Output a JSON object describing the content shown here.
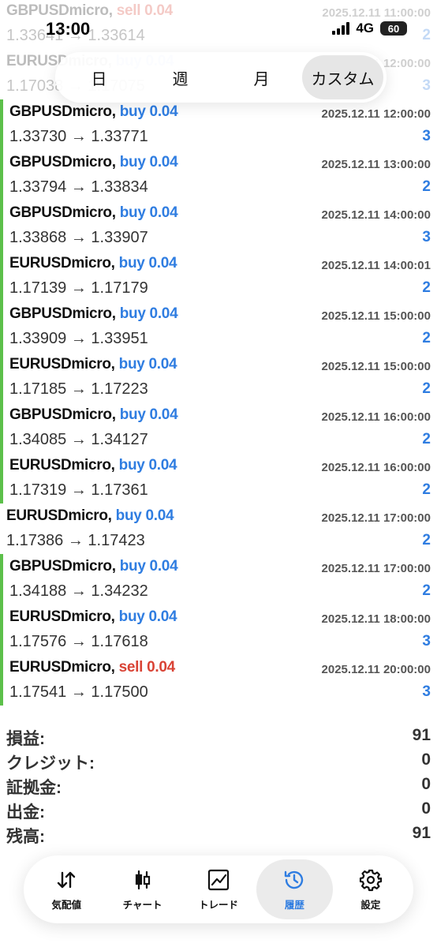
{
  "status": {
    "time": "13:00",
    "network": "4G",
    "battery": "60"
  },
  "periods": [
    {
      "label": "日",
      "active": false
    },
    {
      "label": "週",
      "active": false
    },
    {
      "label": "月",
      "active": false
    },
    {
      "label": "カスタム",
      "active": true
    }
  ],
  "deals": [
    {
      "symbol": "GBPUSDmicro,",
      "side": "sell",
      "side_label": "sell 0.04",
      "time": "2025.12.11 11:00:00",
      "price": "1.33641 → 1.33614",
      "profit": "2",
      "faded": true,
      "green": false
    },
    {
      "symbol": "EURUSDmicro,",
      "side": "buy",
      "side_label": "buy 0.04",
      "time": "2025.12.11 12:00:00",
      "price": "1.17038 → 1.17075",
      "profit": "3",
      "faded": true,
      "green": false
    },
    {
      "symbol": "GBPUSDmicro,",
      "side": "buy",
      "side_label": "buy 0.04",
      "time": "2025.12.11 12:00:00",
      "price": "1.33730 → 1.33771",
      "profit": "3",
      "faded": false,
      "green": true
    },
    {
      "symbol": "GBPUSDmicro,",
      "side": "buy",
      "side_label": "buy 0.04",
      "time": "2025.12.11 13:00:00",
      "price": "1.33794 → 1.33834",
      "profit": "2",
      "faded": false,
      "green": true
    },
    {
      "symbol": "GBPUSDmicro,",
      "side": "buy",
      "side_label": "buy 0.04",
      "time": "2025.12.11 14:00:00",
      "price": "1.33868 → 1.33907",
      "profit": "3",
      "faded": false,
      "green": true
    },
    {
      "symbol": "EURUSDmicro,",
      "side": "buy",
      "side_label": "buy 0.04",
      "time": "2025.12.11 14:00:01",
      "price": "1.17139 → 1.17179",
      "profit": "2",
      "faded": false,
      "green": true
    },
    {
      "symbol": "GBPUSDmicro,",
      "side": "buy",
      "side_label": "buy 0.04",
      "time": "2025.12.11 15:00:00",
      "price": "1.33909 → 1.33951",
      "profit": "2",
      "faded": false,
      "green": true
    },
    {
      "symbol": "EURUSDmicro,",
      "side": "buy",
      "side_label": "buy 0.04",
      "time": "2025.12.11 15:00:00",
      "price": "1.17185 → 1.17223",
      "profit": "2",
      "faded": false,
      "green": true
    },
    {
      "symbol": "GBPUSDmicro,",
      "side": "buy",
      "side_label": "buy 0.04",
      "time": "2025.12.11 16:00:00",
      "price": "1.34085 → 1.34127",
      "profit": "2",
      "faded": false,
      "green": true
    },
    {
      "symbol": "EURUSDmicro,",
      "side": "buy",
      "side_label": "buy 0.04",
      "time": "2025.12.11 16:00:00",
      "price": "1.17319 → 1.17361",
      "profit": "2",
      "faded": false,
      "green": true
    },
    {
      "symbol": "EURUSDmicro,",
      "side": "buy",
      "side_label": "buy 0.04",
      "time": "2025.12.11 17:00:00",
      "price": "1.17386 → 1.17423",
      "profit": "2",
      "faded": false,
      "green": false
    },
    {
      "symbol": "GBPUSDmicro,",
      "side": "buy",
      "side_label": "buy 0.04",
      "time": "2025.12.11 17:00:00",
      "price": "1.34188 → 1.34232",
      "profit": "2",
      "faded": false,
      "green": true
    },
    {
      "symbol": "EURUSDmicro,",
      "side": "buy",
      "side_label": "buy 0.04",
      "time": "2025.12.11 18:00:00",
      "price": "1.17576 → 1.17618",
      "profit": "3",
      "faded": false,
      "green": true
    },
    {
      "symbol": "EURUSDmicro,",
      "side": "sell",
      "side_label": "sell 0.04",
      "time": "2025.12.11 20:00:00",
      "price": "1.17541 → 1.17500",
      "profit": "3",
      "faded": false,
      "green": true
    }
  ],
  "summary": [
    {
      "label": "損益:",
      "value": "91"
    },
    {
      "label": "クレジット:",
      "value": "0"
    },
    {
      "label": "証拠金:",
      "value": "0"
    },
    {
      "label": "出金:",
      "value": "0"
    },
    {
      "label": "残高:",
      "value": "91"
    }
  ],
  "tabs": [
    {
      "label": "気配値",
      "icon": "quotes-arrows-icon",
      "active": false
    },
    {
      "label": "チャート",
      "icon": "candlestick-chart-icon",
      "active": false
    },
    {
      "label": "トレード",
      "icon": "trade-chart-icon",
      "active": false
    },
    {
      "label": "履歴",
      "icon": "history-clock-icon",
      "active": true
    },
    {
      "label": "設定",
      "icon": "gear-icon",
      "active": false
    }
  ],
  "colors": {
    "buy": "#2f7de1",
    "sell": "#d94335",
    "profit": "#2f7de1",
    "accent_bar": "#5cc04a"
  }
}
